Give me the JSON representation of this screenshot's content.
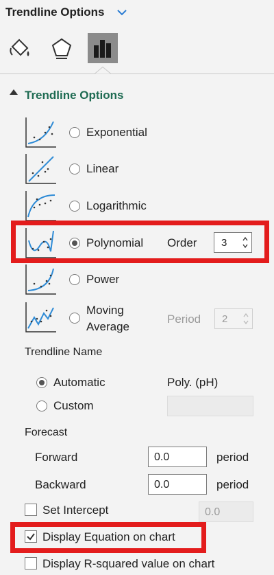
{
  "header": {
    "title": "Trendline Options",
    "tabs": [
      {
        "name": "fill-line-tab",
        "icon": "paint-bucket-icon"
      },
      {
        "name": "effects-tab",
        "icon": "pentagon-icon"
      },
      {
        "name": "trendline-options-tab",
        "icon": "bar-chart-icon",
        "active": true
      }
    ]
  },
  "section": {
    "title": "Trendline Options"
  },
  "types": {
    "exponential": "Exponential",
    "linear": "Linear",
    "logarithmic": "Logarithmic",
    "polynomial": "Polynomial",
    "power": "Power",
    "moving_average_line1": "Moving",
    "moving_average_line2": "Average"
  },
  "polynomial_order": {
    "label": "Order",
    "value": "3"
  },
  "moving_period": {
    "label": "Period",
    "value": "2"
  },
  "name": {
    "heading": "Trendline Name",
    "automatic_label": "Automatic",
    "automatic_value": "Poly. (pH)",
    "custom_label": "Custom",
    "custom_value": ""
  },
  "forecast": {
    "heading": "Forecast",
    "forward_label": "Forward",
    "forward_value": "0.0",
    "forward_unit": "period",
    "backward_label": "Backward",
    "backward_value": "0.0",
    "backward_unit": "period"
  },
  "options": {
    "set_intercept_label": "Set Intercept",
    "set_intercept_value": "0.0",
    "display_equation_label": "Display Equation on chart",
    "display_equation_checked": true,
    "display_rsquared_label": "Display R-squared value on chart",
    "display_rsquared_checked": false
  },
  "colors": {
    "section_title": "#1e6b52",
    "highlight": "#e31c1c",
    "trend_line": "#2e8bd6"
  }
}
